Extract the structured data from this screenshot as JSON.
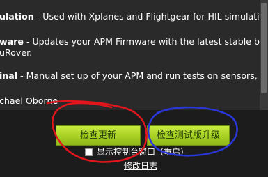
{
  "features": [
    {
      "name": "ulation",
      "desc": " - Used with Xplanes and Flightgear for HIL simulation with"
    },
    {
      "name": "ware",
      "desc": " - Updates your APM Firmware with the latest stable build,",
      "cont": "uRover."
    },
    {
      "name": "inal",
      "desc": " - Manual set up of your APM and run tests on sensors, log re"
    }
  ],
  "credits": "chael Oborne",
  "buttons": {
    "check_update": "检查更新",
    "check_beta": "检查测试版升级"
  },
  "console_checkbox_label": "显示控制台窗口（重启）",
  "changelog_link": "修改日志",
  "colors": {
    "button_green": "#b5dc2e",
    "annotation_red": "#e0161c",
    "annotation_blue": "#2a37d8"
  }
}
